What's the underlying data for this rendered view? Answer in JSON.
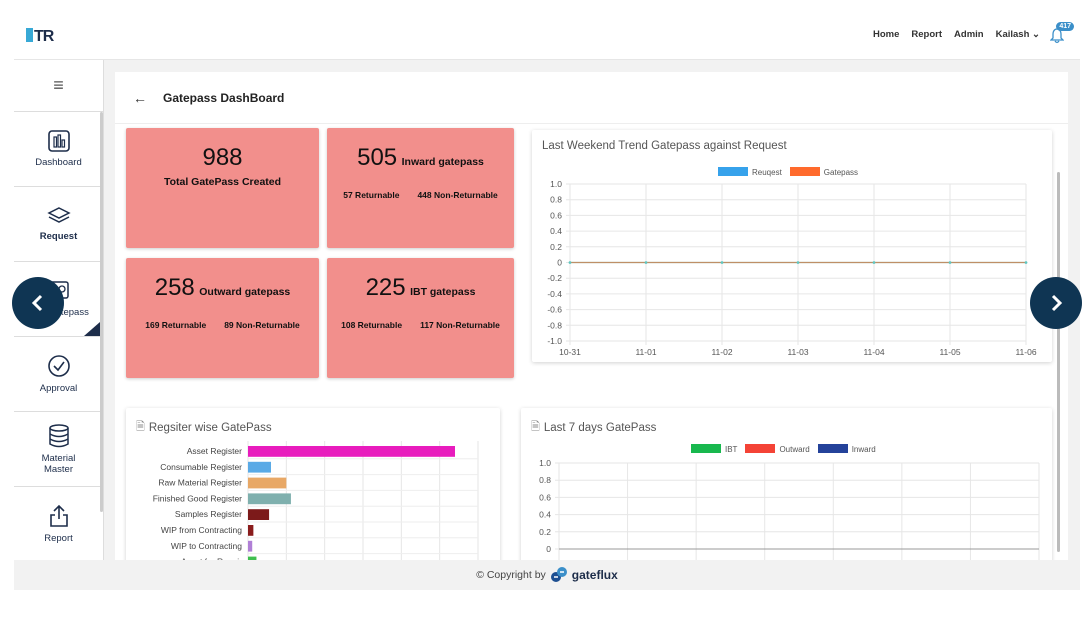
{
  "header": {
    "logo": "TR",
    "nav": [
      "Home",
      "Report",
      "Admin",
      "Kailash"
    ],
    "notification_count": "417"
  },
  "sidebar": {
    "items": [
      {
        "label": "Dashboard",
        "icon": "chart-icon"
      },
      {
        "label": "Request",
        "icon": "layers-icon"
      },
      {
        "label": "Gatepass",
        "icon": "gatepass-icon"
      },
      {
        "label": "Approval",
        "icon": "check-circle-icon"
      },
      {
        "label": "Material Master",
        "icon": "database-icon"
      },
      {
        "label": "Report",
        "icon": "share-icon"
      }
    ]
  },
  "page": {
    "title": "Gatepass DashBoard"
  },
  "stats": {
    "total": {
      "value": "988",
      "label": "Total GatePass Created"
    },
    "inward": {
      "value": "505",
      "label": "Inward gatepass",
      "returnable": "57 Returnable",
      "non_returnable": "448 Non-Returnable"
    },
    "outward": {
      "value": "258",
      "label": "Outward gatepass",
      "returnable": "169 Returnable",
      "non_returnable": "89 Non-Returnable"
    },
    "ibt": {
      "value": "225",
      "label": "IBT gatepass",
      "returnable": "108 Returnable",
      "non_returnable": "117 Non-Returnable"
    }
  },
  "colors": {
    "card_bg": "#f28f8c",
    "accent": "#0f3553"
  },
  "chart_data": [
    {
      "type": "line",
      "title": "Last Weekend Trend Gatepass against Request",
      "x": [
        "10-31",
        "11-01",
        "11-02",
        "11-03",
        "11-04",
        "11-05",
        "11-06"
      ],
      "series": [
        {
          "name": "Reuqest",
          "color": "#36a2eb",
          "values": [
            0,
            0,
            0,
            0,
            0,
            0,
            0
          ]
        },
        {
          "name": "Gatepass",
          "color": "#ff6a2c",
          "values": [
            0,
            0,
            0,
            0,
            0,
            0,
            0
          ]
        }
      ],
      "ylim": [
        -1.0,
        1.0
      ],
      "yticks": [
        "1.0",
        "0.8",
        "0.6",
        "0.4",
        "0.2",
        "0",
        "-0.2",
        "-0.4",
        "-0.6",
        "-0.8",
        "-1.0"
      ],
      "legend": "top",
      "grid": true
    },
    {
      "type": "bar",
      "title": "Regsiter wise GatePass",
      "orientation": "horizontal",
      "categories": [
        "Asset Register",
        "Consumable Register",
        "Raw Material Register",
        "Finished Good Register",
        "Samples Register",
        "WIP from Contracting",
        "WIP to Contracting",
        "Asset for Repair"
      ],
      "values": [
        540,
        60,
        100,
        112,
        55,
        14,
        11,
        22
      ],
      "colors": [
        "#e81cbd",
        "#5aaae6",
        "#e8a866",
        "#7fb0ae",
        "#7c1a1a",
        "#8a1c1c",
        "#b07fd6",
        "#3fbf4f"
      ],
      "xlim": [
        0,
        600
      ],
      "grid": true
    },
    {
      "type": "bar",
      "title": "Last 7 days GatePass",
      "series": [
        {
          "name": "IBT",
          "color": "#18b84e",
          "values": []
        },
        {
          "name": "Outward",
          "color": "#f44336",
          "values": []
        },
        {
          "name": "Inward",
          "color": "#24429a",
          "values": []
        }
      ],
      "yticks": [
        "1.0",
        "0.8",
        "0.6",
        "0.4",
        "0.2",
        "0"
      ],
      "ylim": [
        0,
        1.0
      ],
      "legend": "top",
      "grid": true
    }
  ],
  "footer": {
    "copyright": "© Copyright by",
    "brand": "gateflux"
  }
}
